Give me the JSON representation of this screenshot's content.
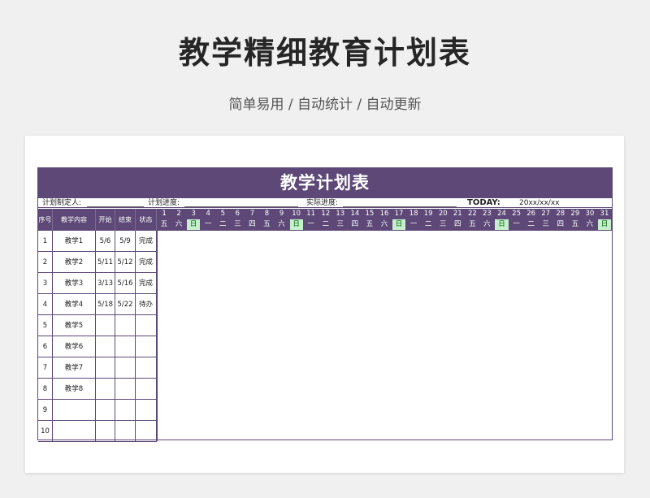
{
  "header": {
    "title": "教学精细教育计划表",
    "subtitle": "简单易用 / 自动统计 / 自动更新"
  },
  "sheet": {
    "title": "教学计划表",
    "planner_label": "计划制定人:",
    "plan_progress_label": "计划进度:",
    "actual_progress_label": "实际进度:",
    "today_label": "TODAY:",
    "today_value": "20xx/xx/xx",
    "columns": [
      "序号",
      "教学内容",
      "开始",
      "结束",
      "状态"
    ],
    "days": [
      "1",
      "2",
      "3",
      "4",
      "5",
      "6",
      "7",
      "8",
      "9",
      "10",
      "11",
      "12",
      "13",
      "14",
      "15",
      "16",
      "17",
      "18",
      "19",
      "20",
      "21",
      "22",
      "23",
      "24",
      "25",
      "26",
      "27",
      "28",
      "29",
      "30",
      "31"
    ],
    "weekdays": [
      "五",
      "六",
      "日",
      "一",
      "二",
      "三",
      "四",
      "五",
      "六",
      "日",
      "一",
      "二",
      "三",
      "四",
      "五",
      "六",
      "日",
      "一",
      "二",
      "三",
      "四",
      "五",
      "六",
      "日",
      "一",
      "二",
      "三",
      "四",
      "五",
      "六",
      "日"
    ],
    "rows": [
      {
        "no": "1",
        "content": "教学1",
        "start": "5/6",
        "end": "5/9",
        "status": "完成"
      },
      {
        "no": "2",
        "content": "教学2",
        "start": "5/11",
        "end": "5/12",
        "status": "完成"
      },
      {
        "no": "3",
        "content": "教学3",
        "start": "3/13",
        "end": "5/16",
        "status": "完成"
      },
      {
        "no": "4",
        "content": "教学4",
        "start": "5/18",
        "end": "5/22",
        "status": "待办"
      },
      {
        "no": "5",
        "content": "教学5",
        "start": "",
        "end": "",
        "status": ""
      },
      {
        "no": "6",
        "content": "教学6",
        "start": "",
        "end": "",
        "status": ""
      },
      {
        "no": "7",
        "content": "教学7",
        "start": "",
        "end": "",
        "status": ""
      },
      {
        "no": "8",
        "content": "教学8",
        "start": "",
        "end": "",
        "status": ""
      },
      {
        "no": "9",
        "content": "",
        "start": "",
        "end": "",
        "status": ""
      },
      {
        "no": "10",
        "content": "",
        "start": "",
        "end": "",
        "status": ""
      }
    ]
  },
  "colors": {
    "accent": "#5d4877",
    "sunday_bg": "#c6efce",
    "sunday_text": "#006100"
  }
}
